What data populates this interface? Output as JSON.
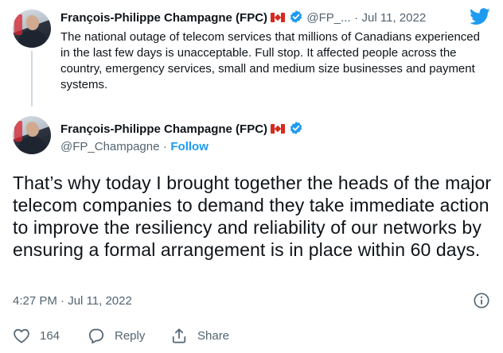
{
  "parent_tweet": {
    "author_name": "François-Philippe Champagne (FPC)",
    "handle": "@FP_...",
    "separator": "·",
    "date": "Jul 11, 2022",
    "text": "The national outage of telecom services that millions of Canadians experienced in the last few days is unacceptable. Full stop. It affected people across the country, emergency services, small and medium size businesses and payment systems."
  },
  "main_tweet": {
    "author_name": "François-Philippe Champagne (FPC)",
    "handle": "@FP_Champagne",
    "separator": "·",
    "follow_label": "Follow",
    "text": "That’s why today I brought together the heads of the major telecom companies to demand they take immediate action to improve the resiliency and reliability of our networks by ensuring a formal arrangement is in place within 60 days.",
    "timestamp": "4:27 PM · Jul 11, 2022",
    "likes_count": "164",
    "reply_label": "Reply",
    "share_label": "Share"
  },
  "icons": {
    "brand": "twitter-bird-icon",
    "verified": "verified-badge-icon",
    "flag": "canada-flag-icon",
    "info": "info-icon",
    "like": "heart-icon",
    "reply": "reply-bubble-icon",
    "share": "share-icon"
  },
  "colors": {
    "accent": "#1d9bf0",
    "text": "#0f1419",
    "muted": "#536471"
  }
}
